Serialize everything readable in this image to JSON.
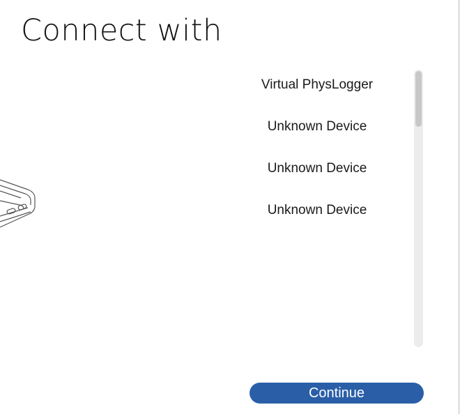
{
  "header": {
    "title": "Connect with"
  },
  "illustration": {
    "icon": "physlogger-device-icon"
  },
  "devices": {
    "items": [
      {
        "label": "Virtual PhysLogger"
      },
      {
        "label": "Unknown Device"
      },
      {
        "label": "Unknown Device"
      },
      {
        "label": "Unknown Device"
      }
    ]
  },
  "actions": {
    "continue_label": "Continue"
  },
  "colors": {
    "accent": "#2a5fa8",
    "scrollbar_track": "#ececec",
    "scrollbar_thumb": "#c8c8c8"
  }
}
